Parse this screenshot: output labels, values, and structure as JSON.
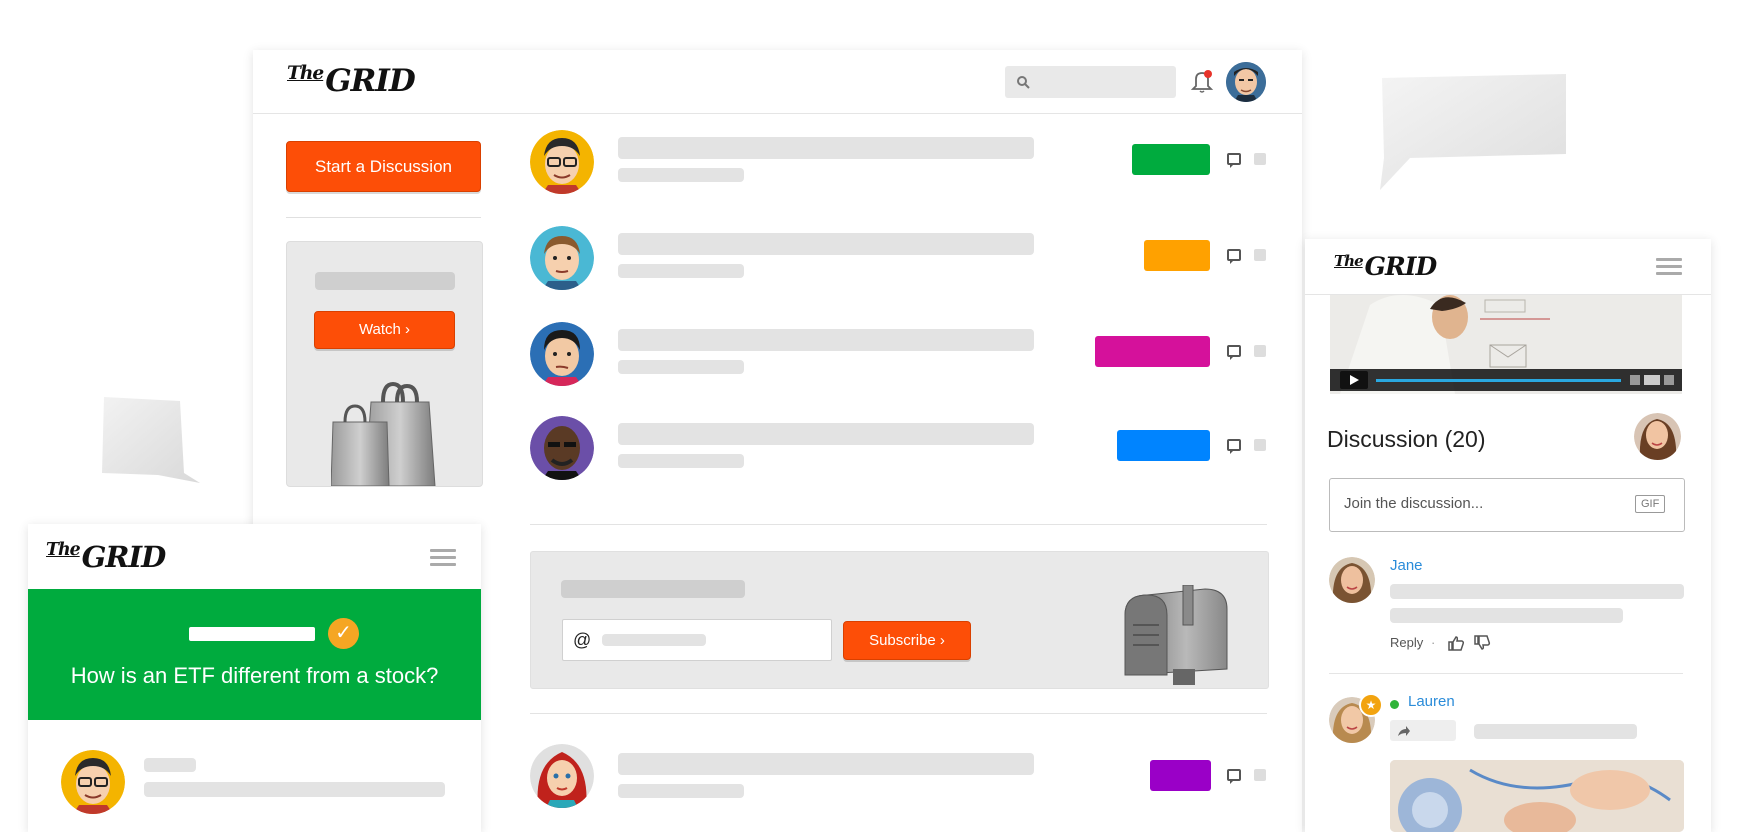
{
  "colors": {
    "accent_orange": "#fd4e07",
    "green": "#00ab3e",
    "orange": "#ffa100",
    "magenta": "#d5119b",
    "blue": "#0084ff",
    "purple": "#9a00c7",
    "link_blue": "#2b8cd9"
  },
  "main_window": {
    "logo": {
      "the": "The",
      "grid": "GRID"
    },
    "search_icon": "search-icon",
    "bell_icon": "bell-icon",
    "start_discussion_label": "Start a Discussion",
    "watch_label": "Watch ›",
    "subscribe": {
      "at_symbol": "@",
      "button_label": "Subscribe ›"
    }
  },
  "right_window": {
    "logo": {
      "the": "The",
      "grid": "GRID"
    },
    "discussion_title": "Discussion (20)",
    "join_placeholder": "Join the discussion...",
    "gif_label": "GIF",
    "comments": [
      {
        "author": "Jane",
        "reply_label": "Reply",
        "separator": "·"
      },
      {
        "author": "Lauren"
      }
    ]
  },
  "left_window": {
    "logo": {
      "the": "The",
      "grid": "GRID"
    },
    "question": "How is an ETF different from a stock?"
  }
}
